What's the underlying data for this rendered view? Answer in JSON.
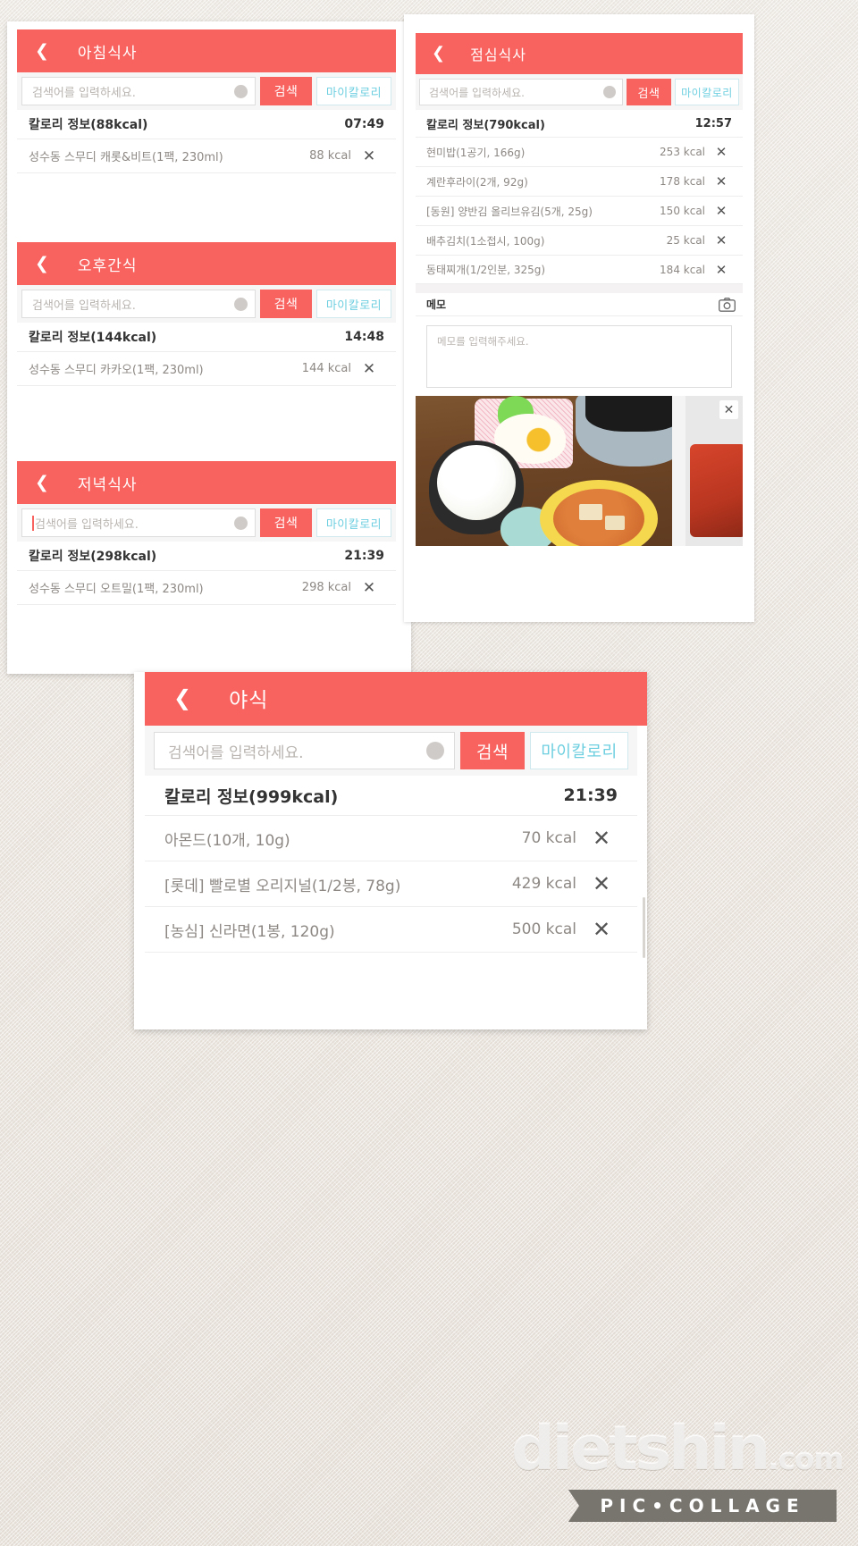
{
  "common": {
    "back_icon": "chevron-left-icon",
    "search_placeholder": "검색어를 입력하세요.",
    "clear_icon": "✕",
    "search_button": "검색",
    "mycalorie_button": "마이칼로리",
    "delete_icon": "✕",
    "accent_color": "#f8625f",
    "mycalorie_color": "#6ecfe0",
    "muted_text_color": "#8d8884"
  },
  "watermarks": {
    "dietshin": "dietshin",
    "dietshin_domain": ".com",
    "piccollage": "PIC•COLLAGE"
  },
  "cards": {
    "breakfast": {
      "title": "아침식사",
      "summary_label": "칼로리 정보(88kcal)",
      "time": "07:49",
      "items": [
        {
          "name": "성수동 스무디 캐롯&비트(1팩, 230ml)",
          "kcal": "88 kcal"
        }
      ]
    },
    "afternoon_snack": {
      "title": "오후간식",
      "summary_label": "칼로리 정보(144kcal)",
      "time": "14:48",
      "items": [
        {
          "name": "성수동 스무디 카카오(1팩, 230ml)",
          "kcal": "144 kcal"
        }
      ]
    },
    "dinner": {
      "title": "저녁식사",
      "summary_label": "칼로리 정보(298kcal)",
      "time": "21:39",
      "items": [
        {
          "name": "성수동 스무디 오트밀(1팩, 230ml)",
          "kcal": "298 kcal"
        }
      ]
    },
    "lunch": {
      "title": "점심식사",
      "summary_label": "칼로리 정보(790kcal)",
      "time": "12:57",
      "items": [
        {
          "name": "현미밥(1공기, 166g)",
          "kcal": "253 kcal"
        },
        {
          "name": "계란후라이(2개, 92g)",
          "kcal": "178 kcal"
        },
        {
          "name": "[동원] 양반김 올리브유김(5개, 25g)",
          "kcal": "150 kcal"
        },
        {
          "name": "배추김치(1소접시, 100g)",
          "kcal": "25 kcal"
        },
        {
          "name": "동태찌개(1/2인분, 325g)",
          "kcal": "184 kcal"
        }
      ],
      "memo_label": "메모",
      "memo_camera_icon": "camera-icon",
      "memo_placeholder": "메모를 입력해주세요.",
      "photo_close_icon": "✕"
    },
    "late_night": {
      "title": "야식",
      "summary_label": "칼로리 정보(999kcal)",
      "time": "21:39",
      "items": [
        {
          "name": "아몬드(10개, 10g)",
          "kcal": "70 kcal"
        },
        {
          "name": "[롯데] 빨로별 오리지널(1/2봉, 78g)",
          "kcal": "429 kcal"
        },
        {
          "name": "[농심] 신라면(1봉, 120g)",
          "kcal": "500 kcal"
        }
      ]
    }
  }
}
